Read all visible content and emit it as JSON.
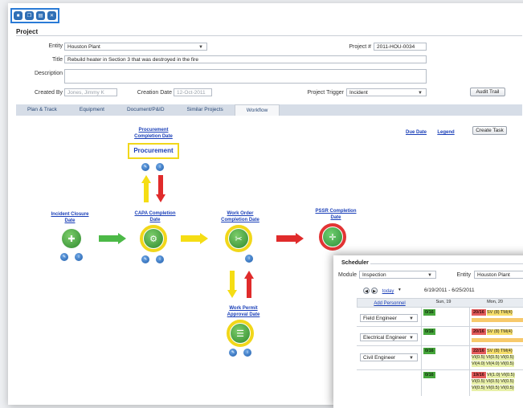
{
  "toolbar": {
    "buttons": [
      "save-icon",
      "copy-icon",
      "print-icon",
      "delete-icon"
    ]
  },
  "project": {
    "section_title": "Project",
    "entity_label": "Entity",
    "entity_value": "Houston Plant",
    "project_no_label": "Project #",
    "project_no_value": "2011-HOU-0034",
    "title_label": "Title",
    "title_value": "Rebuild heater in Section 3 that was destroyed in the fire",
    "description_label": "Description",
    "description_value": "",
    "created_by_label": "Created By",
    "created_by_value": "Jones, Jimmy K",
    "creation_date_label": "Creation Date",
    "creation_date_value": "12-Oct-2011",
    "trigger_label": "Project Trigger",
    "trigger_value": "Incident",
    "audit_trail_label": "Audit Trail"
  },
  "tabs": [
    {
      "label": "Plan & Track",
      "active": false
    },
    {
      "label": "Equipment",
      "active": false
    },
    {
      "label": "Document/P&ID",
      "active": false
    },
    {
      "label": "Similar Projects",
      "active": false
    },
    {
      "label": "Workflow",
      "active": true
    }
  ],
  "workflow": {
    "due_date_link": "Due Date",
    "legend_link": "Legend",
    "create_task_label": "Create Task",
    "procurement_completion_link": "Procurement Completion Date",
    "procurement_box": "Procurement",
    "incident_closure_link": "Incident Closure Date",
    "capa_completion_link": "CAPA Completion Date",
    "work_order_completion_link": "Work Order Completion Date",
    "pssr_completion_link": "PSSR Completion Date",
    "work_permit_approval_link": "Work Permit Approval Date",
    "colors": {
      "arrow_green": "#4cb947",
      "arrow_yellow": "#f5dd14",
      "arrow_red": "#e02b2b",
      "ring_yellow": "#f1d71a",
      "ring_red": "#e23434"
    }
  },
  "scheduler": {
    "title": "Scheduler",
    "module_label": "Module",
    "module_value": "Inspection",
    "entity_label": "Entity",
    "entity_value": "Houston Plant",
    "today_link": "today",
    "date_range": "6/19/2011 - 6/25/2011",
    "add_personnel_link": "Add Personnel",
    "columns": [
      "Sun, 19",
      "Mon, 20"
    ],
    "rows": [
      {
        "role": "Field Engineer",
        "sun": "0/16",
        "mon_count": "20/16",
        "mon_text": "SV (8)  TM(4)",
        "mon_extra": []
      },
      {
        "role": "Electrical Engineer",
        "sun": "0/16",
        "mon_count": "20/16",
        "mon_text": "SV (8)  TM(4)",
        "mon_extra": []
      },
      {
        "role": "Civil Engineer",
        "sun": "0/16",
        "mon_count": "22/16",
        "mon_text": "SV (8)  TM(4)",
        "mon_extra": [
          "VI(0.5) VI(0.5) VI(0.5)",
          "VI(4.0) VI(4.0) VI(0.5)"
        ]
      },
      {
        "role": "",
        "sun": "0/16",
        "mon_count": "19/16",
        "mon_text": "VI(1.0) VI(0.5)",
        "mon_extra": [
          "VI(0.5) VI(0.5) VI(0.5)",
          "VI(0.5) VI(0.5) VI(0.5)"
        ]
      }
    ]
  }
}
